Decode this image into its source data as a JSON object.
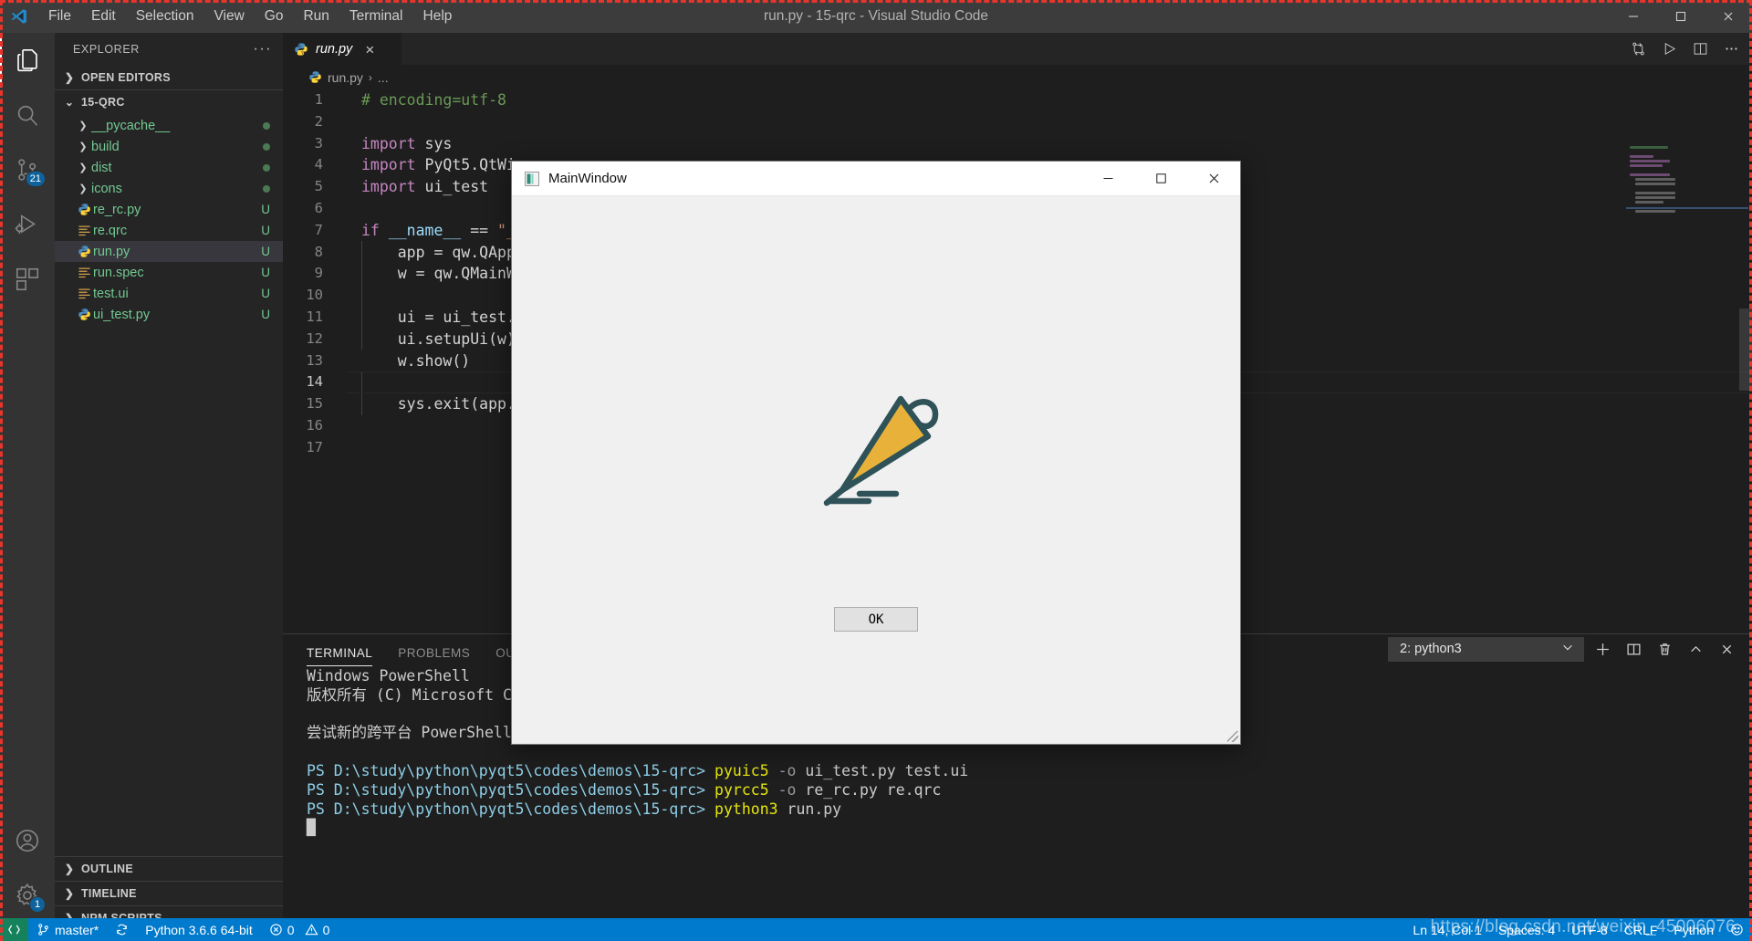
{
  "titlebar": {
    "app_icon": "vscode-logo",
    "title": "run.py - 15-qrc - Visual Studio Code",
    "menus": [
      "File",
      "Edit",
      "Selection",
      "View",
      "Go",
      "Run",
      "Terminal",
      "Help"
    ],
    "window_controls": [
      "minimize-icon",
      "maximize-icon",
      "close-icon"
    ]
  },
  "activitybar": {
    "items": [
      {
        "name": "explorer-icon",
        "label": "Explorer",
        "active": true,
        "badge": ""
      },
      {
        "name": "search-icon",
        "label": "Search",
        "active": false,
        "badge": ""
      },
      {
        "name": "source-control-icon",
        "label": "Source Control",
        "active": false,
        "badge": "21"
      },
      {
        "name": "run-debug-icon",
        "label": "Run and Debug",
        "active": false,
        "badge": ""
      },
      {
        "name": "extensions-icon",
        "label": "Extensions",
        "active": false,
        "badge": ""
      }
    ],
    "bottom_items": [
      {
        "name": "account-icon",
        "label": "Accounts",
        "badge": ""
      },
      {
        "name": "gear-icon",
        "label": "Manage",
        "badge": "1"
      }
    ]
  },
  "sidebar": {
    "title": "EXPLORER",
    "more_actions": "···",
    "open_editors": "OPEN EDITORS",
    "project": "15-QRC",
    "files": [
      {
        "label": "__pycache__",
        "icon": "folder-icon",
        "kind": "folder",
        "badge": "dot"
      },
      {
        "label": "build",
        "icon": "folder-icon",
        "kind": "folder",
        "badge": "dot"
      },
      {
        "label": "dist",
        "icon": "folder-icon",
        "kind": "folder",
        "badge": "dot"
      },
      {
        "label": "icons",
        "icon": "folder-icon",
        "kind": "folder",
        "badge": "dot"
      },
      {
        "label": "re_rc.py",
        "icon": "python-icon",
        "kind": "file",
        "badge": "U"
      },
      {
        "label": "re.qrc",
        "icon": "xml-icon",
        "kind": "file",
        "badge": "U"
      },
      {
        "label": "run.py",
        "icon": "python-icon",
        "kind": "file",
        "badge": "U",
        "selected": true
      },
      {
        "label": "run.spec",
        "icon": "xml-icon",
        "kind": "file",
        "badge": "U"
      },
      {
        "label": "test.ui",
        "icon": "xml-icon",
        "kind": "file",
        "badge": "U"
      },
      {
        "label": "ui_test.py",
        "icon": "python-icon",
        "kind": "file",
        "badge": "U"
      }
    ],
    "bottom_sections": [
      "OUTLINE",
      "TIMELINE",
      "NPM SCRIPTS"
    ]
  },
  "editor": {
    "tab": {
      "label": "run.py",
      "icon": "python-icon",
      "close": "×"
    },
    "actions": [
      "diff-icon",
      "run-play-icon",
      "split-editor-icon",
      "more-actions-icon"
    ],
    "breadcrumb": {
      "file": "run.py",
      "separator": "›",
      "tail": "..."
    },
    "lines": [
      {
        "n": 1,
        "tokens": [
          {
            "t": "# encoding=utf-8",
            "c": "cmt"
          }
        ]
      },
      {
        "n": 2,
        "tokens": []
      },
      {
        "n": 3,
        "tokens": [
          {
            "t": "import",
            "c": "kw"
          },
          {
            "t": " sys",
            "c": "plain"
          }
        ]
      },
      {
        "n": 4,
        "tokens": [
          {
            "t": "import",
            "c": "kw"
          },
          {
            "t": " PyQt5.QtWi",
            "c": "plain"
          }
        ]
      },
      {
        "n": 5,
        "tokens": [
          {
            "t": "import",
            "c": "kw"
          },
          {
            "t": " ui_test",
            "c": "plain"
          }
        ]
      },
      {
        "n": 6,
        "tokens": []
      },
      {
        "n": 7,
        "tokens": [
          {
            "t": "if",
            "c": "kw"
          },
          {
            "t": " ",
            "c": "plain"
          },
          {
            "t": "__name__",
            "c": "var"
          },
          {
            "t": " == ",
            "c": "plain"
          },
          {
            "t": "\"_",
            "c": "str"
          }
        ]
      },
      {
        "n": 8,
        "tokens": [
          {
            "t": "    app = qw.QApp",
            "c": "plain"
          }
        ]
      },
      {
        "n": 9,
        "tokens": [
          {
            "t": "    w = qw.QMainW",
            "c": "plain"
          }
        ]
      },
      {
        "n": 10,
        "tokens": []
      },
      {
        "n": 11,
        "tokens": [
          {
            "t": "    ui = ui_test.",
            "c": "plain"
          }
        ]
      },
      {
        "n": 12,
        "tokens": [
          {
            "t": "    ui.setupUi(w)",
            "c": "plain"
          }
        ]
      },
      {
        "n": 13,
        "tokens": [
          {
            "t": "    w.show()",
            "c": "plain"
          }
        ]
      },
      {
        "n": 14,
        "tokens": []
      },
      {
        "n": 15,
        "tokens": [
          {
            "t": "    sys.exit(app.",
            "c": "plain"
          }
        ]
      },
      {
        "n": 16,
        "tokens": []
      },
      {
        "n": 17,
        "tokens": []
      }
    ]
  },
  "panel": {
    "tabs": [
      {
        "label": "TERMINAL",
        "active": true
      },
      {
        "label": "PROBLEMS",
        "active": false
      },
      {
        "label": "OUTPUT",
        "active": false
      }
    ],
    "terminal_select": {
      "value": "2: python3",
      "chevron": "chevron-down-icon"
    },
    "actions": [
      "new-terminal-icon",
      "split-terminal-icon",
      "kill-terminal-icon",
      "maximize-panel-icon",
      "close-panel-icon"
    ],
    "output": [
      {
        "segments": [
          {
            "t": "Windows PowerShell",
            "c": "t-white"
          }
        ]
      },
      {
        "segments": [
          {
            "t": "版权所有 (C) Microsoft Co",
            "c": "t-white"
          }
        ]
      },
      {
        "segments": []
      },
      {
        "segments": [
          {
            "t": "尝试新的跨平台 PowerShell",
            "c": "t-white"
          }
        ]
      },
      {
        "segments": []
      },
      {
        "segments": [
          {
            "t": "PS D:\\study\\python\\pyqt5\\codes\\demos\\15-qrc> ",
            "c": "t-cyan"
          },
          {
            "t": "pyuic5",
            "c": "t-yellow"
          },
          {
            "t": " -o",
            "c": "t-dim"
          },
          {
            "t": " ui_test.py test.ui",
            "c": "t-white"
          }
        ]
      },
      {
        "segments": [
          {
            "t": "PS D:\\study\\python\\pyqt5\\codes\\demos\\15-qrc> ",
            "c": "t-cyan"
          },
          {
            "t": "pyrcc5",
            "c": "t-yellow"
          },
          {
            "t": " -o",
            "c": "t-dim"
          },
          {
            "t": " re_rc.py re.qrc",
            "c": "t-white"
          }
        ]
      },
      {
        "segments": [
          {
            "t": "PS D:\\study\\python\\pyqt5\\codes\\demos\\15-qrc> ",
            "c": "t-cyan"
          },
          {
            "t": "python3",
            "c": "t-yellow"
          },
          {
            "t": " run.py",
            "c": "t-white"
          }
        ]
      },
      {
        "segments": [
          {
            "t": "█",
            "c": "t-white"
          }
        ]
      }
    ]
  },
  "statusbar": {
    "left": [
      {
        "name": "remote-indicator",
        "icon": "remote-icon",
        "label": ""
      },
      {
        "name": "git-branch",
        "icon": "branch-icon",
        "label": "master*"
      },
      {
        "name": "git-sync",
        "icon": "sync-icon",
        "label": ""
      },
      {
        "name": "python-interpreter",
        "icon": "",
        "label": "Python 3.6.6 64-bit"
      },
      {
        "name": "problems",
        "icon": "error-warning-icons",
        "label": "0  0"
      }
    ],
    "errors": "0",
    "warnings": "0",
    "right": [
      {
        "name": "editor-position",
        "label": "Ln 14, Col 1"
      },
      {
        "name": "editor-indentation",
        "label": "Spaces: 4"
      },
      {
        "name": "editor-encoding",
        "label": "UTF-8"
      },
      {
        "name": "editor-eol",
        "label": "CRLF"
      },
      {
        "name": "editor-language",
        "label": "Python"
      },
      {
        "name": "feedback-smiley",
        "label": ""
      }
    ]
  },
  "qt_window": {
    "title": "MainWindow",
    "icon": "qt-app-icon",
    "controls": [
      "minimize-icon",
      "maximize-icon",
      "close-icon"
    ],
    "graphic": "umbrella-icon",
    "ok_button": "OK"
  },
  "watermark": "https://blog.csdn.net/weixin_45006076",
  "colors": {
    "accent": "#007acc",
    "sidebar_bg": "#252526",
    "editor_bg": "#1e1e1e",
    "titlebar_bg": "#3c3c3c",
    "git_green": "#73c991",
    "umbrella_body": "#e8b23a",
    "umbrella_outline": "#2f5258",
    "badge_blue": "#0e639c"
  }
}
